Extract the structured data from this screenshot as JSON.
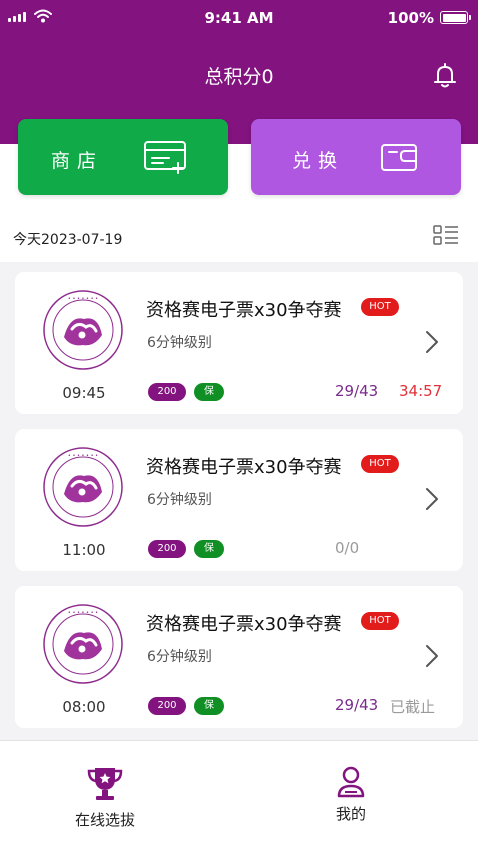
{
  "status_bar": {
    "time": "9:41 AM",
    "battery": "100%"
  },
  "header": {
    "title": "总积分0",
    "icon": "bell-icon"
  },
  "tiles": [
    {
      "label": "商店",
      "icon": "card-add-icon",
      "color": "#10aa49"
    },
    {
      "label": "兑换",
      "icon": "wallet-icon",
      "color": "#b057e2"
    }
  ],
  "date_text": "今天2023-07-19",
  "cards": [
    {
      "title": "资格赛电子票x30争夺赛",
      "hot": "HOT",
      "subtitle": "6分钟级别",
      "time": "09:45",
      "tag_num": "200",
      "tag_bao": "保",
      "count": "29/43",
      "status": "34:57"
    },
    {
      "title": "资格赛电子票x30争夺赛",
      "hot": "HOT",
      "subtitle": "6分钟级别",
      "time": "11:00",
      "tag_num": "200",
      "tag_bao": "保",
      "count": "0/0",
      "status": ""
    },
    {
      "title": "资格赛电子票x30争夺赛",
      "hot": "HOT",
      "subtitle": "6分钟级别",
      "time": "08:00",
      "tag_num": "200",
      "tag_bao": "保",
      "count": "29/43",
      "status": "已截止"
    }
  ],
  "tabbar": [
    {
      "label": "在线选拔",
      "icon": "trophy-icon"
    },
    {
      "label": "我的",
      "icon": "user-icon"
    }
  ],
  "colors": {
    "brand": "#82137f",
    "hot": "#e21b1b",
    "countdown": "#e0313a"
  }
}
